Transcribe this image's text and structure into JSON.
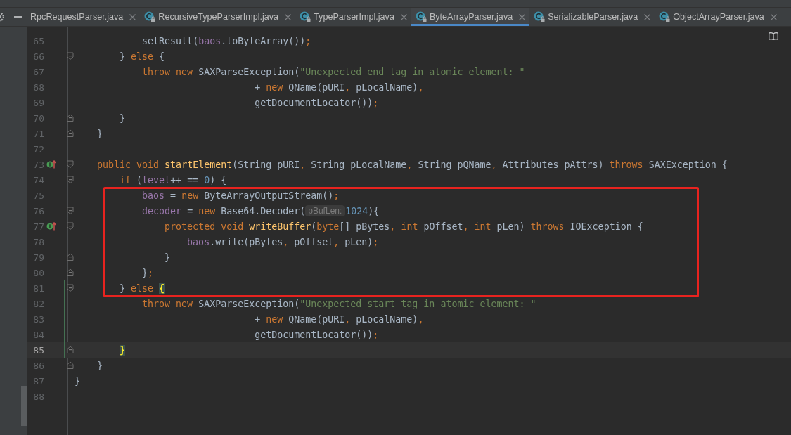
{
  "tabs": [
    {
      "label": "RpcRequestParser.java",
      "selected": false,
      "kind": "cut"
    },
    {
      "label": "RecursiveTypeParserImpl.java",
      "selected": false,
      "kind": "class"
    },
    {
      "label": "TypeParserImpl.java",
      "selected": false,
      "kind": "class"
    },
    {
      "label": "ByteArrayParser.java",
      "selected": true,
      "kind": "class"
    },
    {
      "label": "SerializableParser.java",
      "selected": false,
      "kind": "class"
    },
    {
      "label": "ObjectArrayParser.java",
      "selected": false,
      "kind": "class"
    }
  ],
  "editor": {
    "lines": [
      {
        "kind": "line",
        "number": "65",
        "changed": false,
        "current": false,
        "tokens": [
          {
            "kind": "plain",
            "text": "            setResult("
          },
          {
            "kind": "field",
            "text": "baos"
          },
          {
            "kind": "plain",
            "text": ".toByteArray())"
          },
          {
            "kind": "punct",
            "text": ";"
          }
        ]
      },
      {
        "kind": "line",
        "number": "66",
        "fold_start": true,
        "changed": false,
        "current": false,
        "tokens": [
          {
            "kind": "plain",
            "text": "        } "
          },
          {
            "kind": "kw",
            "text": "else "
          },
          {
            "kind": "plain",
            "text": "{"
          }
        ]
      },
      {
        "kind": "line",
        "number": "67",
        "changed": false,
        "current": false,
        "tokens": [
          {
            "kind": "kw",
            "text": "            throw new "
          },
          {
            "kind": "plain",
            "text": "SAXParseException("
          },
          {
            "kind": "str",
            "text": "\"Unexpected end tag in atomic element: \""
          }
        ]
      },
      {
        "kind": "line",
        "number": "68",
        "changed": false,
        "current": false,
        "tokens": [
          {
            "kind": "plain",
            "text": "                                + "
          },
          {
            "kind": "kw",
            "text": "new "
          },
          {
            "kind": "plain",
            "text": "QName(pURI"
          },
          {
            "kind": "punct",
            "text": ", "
          },
          {
            "kind": "plain",
            "text": "pLocalName)"
          },
          {
            "kind": "punct",
            "text": ","
          }
        ]
      },
      {
        "kind": "line",
        "number": "69",
        "changed": false,
        "current": false,
        "tokens": [
          {
            "kind": "plain",
            "text": "                                getDocumentLocator())"
          },
          {
            "kind": "punct",
            "text": ";"
          }
        ]
      },
      {
        "kind": "line",
        "number": "70",
        "fold_end": true,
        "changed": false,
        "current": false,
        "tokens": [
          {
            "kind": "plain",
            "text": "        }"
          }
        ]
      },
      {
        "kind": "line",
        "number": "71",
        "fold_end": true,
        "changed": false,
        "current": false,
        "tokens": [
          {
            "kind": "plain",
            "text": "    }"
          }
        ]
      },
      {
        "kind": "line",
        "number": "72",
        "changed": false,
        "current": false
      },
      {
        "kind": "line",
        "number": "73",
        "fold_start": true,
        "override": true,
        "changed": false,
        "current": false,
        "tokens": [
          {
            "kind": "kw",
            "text": "    public void "
          },
          {
            "kind": "method",
            "text": "startElement"
          },
          {
            "kind": "plain",
            "text": "(String pURI"
          },
          {
            "kind": "punct",
            "text": ", "
          },
          {
            "kind": "plain",
            "text": "String pLocalName"
          },
          {
            "kind": "punct",
            "text": ", "
          },
          {
            "kind": "plain",
            "text": "String pQName"
          },
          {
            "kind": "punct",
            "text": ", "
          },
          {
            "kind": "plain",
            "text": "Attributes pAttrs) "
          },
          {
            "kind": "kw",
            "text": "throws "
          },
          {
            "kind": "plain",
            "text": "SAXException {"
          }
        ]
      },
      {
        "kind": "line",
        "number": "74",
        "fold_start": true,
        "changed": false,
        "current": false,
        "tokens": [
          {
            "kind": "kw",
            "text": "        if "
          },
          {
            "kind": "plain",
            "text": "("
          },
          {
            "kind": "field",
            "text": "level"
          },
          {
            "kind": "plain",
            "text": "++ == "
          },
          {
            "kind": "num",
            "text": "0"
          },
          {
            "kind": "plain",
            "text": ") {"
          }
        ]
      },
      {
        "kind": "box",
        "color": "#e8231f",
        "lines": [
          {
            "kind": "line",
            "number": "75",
            "changed": false,
            "current": false,
            "tokens": [
              {
                "kind": "field",
                "text": "            baos "
              },
              {
                "kind": "plain",
                "text": "= "
              },
              {
                "kind": "kw",
                "text": "new "
              },
              {
                "kind": "plain",
                "text": "ByteArrayOutputStream()"
              },
              {
                "kind": "punct",
                "text": ";"
              }
            ]
          },
          {
            "kind": "line",
            "number": "76",
            "fold_start": true,
            "changed": false,
            "current": false,
            "tokens": [
              {
                "kind": "field",
                "text": "            decoder "
              },
              {
                "kind": "plain",
                "text": "= "
              },
              {
                "kind": "kw",
                "text": "new "
              },
              {
                "kind": "plain",
                "text": "Base64.Decoder("
              },
              {
                "kind": "hint",
                "text": "pBufLen:"
              },
              {
                "kind": "num",
                "text": "1024"
              },
              {
                "kind": "plain",
                "text": "){"
              }
            ]
          },
          {
            "kind": "line",
            "number": "77",
            "fold_start": true,
            "override": true,
            "changed": false,
            "current": false,
            "tokens": [
              {
                "kind": "kw",
                "text": "                protected void "
              },
              {
                "kind": "method",
                "text": "writeBuffer"
              },
              {
                "kind": "plain",
                "text": "("
              },
              {
                "kind": "kw",
                "text": "byte"
              },
              {
                "kind": "plain",
                "text": "[] pBytes"
              },
              {
                "kind": "punct",
                "text": ", "
              },
              {
                "kind": "kw",
                "text": "int "
              },
              {
                "kind": "plain",
                "text": "pOffset"
              },
              {
                "kind": "punct",
                "text": ", "
              },
              {
                "kind": "kw",
                "text": "int "
              },
              {
                "kind": "plain",
                "text": "pLen) "
              },
              {
                "kind": "kw",
                "text": "throws "
              },
              {
                "kind": "plain",
                "text": "IOException {"
              }
            ]
          },
          {
            "kind": "line",
            "number": "78",
            "changed": false,
            "current": false,
            "tokens": [
              {
                "kind": "field",
                "text": "                    baos"
              },
              {
                "kind": "plain",
                "text": ".write(pBytes"
              },
              {
                "kind": "punct",
                "text": ", "
              },
              {
                "kind": "plain",
                "text": "pOffset"
              },
              {
                "kind": "punct",
                "text": ", "
              },
              {
                "kind": "plain",
                "text": "pLen)"
              },
              {
                "kind": "punct",
                "text": ";"
              }
            ]
          },
          {
            "kind": "line",
            "number": "79",
            "fold_end": true,
            "changed": false,
            "current": false,
            "tokens": [
              {
                "kind": "plain",
                "text": "                }"
              }
            ]
          },
          {
            "kind": "line",
            "number": "80",
            "fold_end": true,
            "changed": false,
            "current": false,
            "tokens": [
              {
                "kind": "plain",
                "text": "            }"
              },
              {
                "kind": "punct",
                "text": ";"
              }
            ]
          },
          {
            "kind": "line",
            "number": "81",
            "fold_start": true,
            "changed": true,
            "current": false,
            "tokens": [
              {
                "kind": "plain",
                "text": "        } "
              },
              {
                "kind": "kw",
                "text": "else "
              },
              {
                "kind": "brace",
                "text": "{"
              }
            ]
          }
        ]
      },
      {
        "kind": "line",
        "number": "82",
        "changed": true,
        "current": false,
        "tokens": [
          {
            "kind": "kw",
            "text": "            throw new "
          },
          {
            "kind": "plain",
            "text": "SAXParseException("
          },
          {
            "kind": "str",
            "text": "\"Unexpected start tag in atomic element: \""
          }
        ]
      },
      {
        "kind": "line",
        "number": "83",
        "changed": true,
        "current": false,
        "tokens": [
          {
            "kind": "plain",
            "text": "                                + "
          },
          {
            "kind": "kw",
            "text": "new "
          },
          {
            "kind": "plain",
            "text": "QName(pURI"
          },
          {
            "kind": "punct",
            "text": ", "
          },
          {
            "kind": "plain",
            "text": "pLocalName)"
          },
          {
            "kind": "punct",
            "text": ","
          }
        ]
      },
      {
        "kind": "line",
        "number": "84",
        "changed": true,
        "current": false,
        "tokens": [
          {
            "kind": "plain",
            "text": "                                getDocumentLocator())"
          },
          {
            "kind": "punct",
            "text": ";"
          }
        ]
      },
      {
        "kind": "line",
        "number": "85",
        "fold_end": true,
        "changed": true,
        "current": true,
        "tokens": [
          {
            "kind": "brace",
            "text": "        }"
          }
        ]
      },
      {
        "kind": "line",
        "number": "86",
        "fold_end": true,
        "changed": false,
        "current": false,
        "tokens": [
          {
            "kind": "plain",
            "text": "    }"
          }
        ]
      },
      {
        "kind": "line",
        "number": "87",
        "changed": false,
        "current": false,
        "tokens": [
          {
            "kind": "plain",
            "text": "}"
          }
        ]
      },
      {
        "kind": "line",
        "number": "88",
        "changed": false,
        "current": false
      }
    ]
  }
}
